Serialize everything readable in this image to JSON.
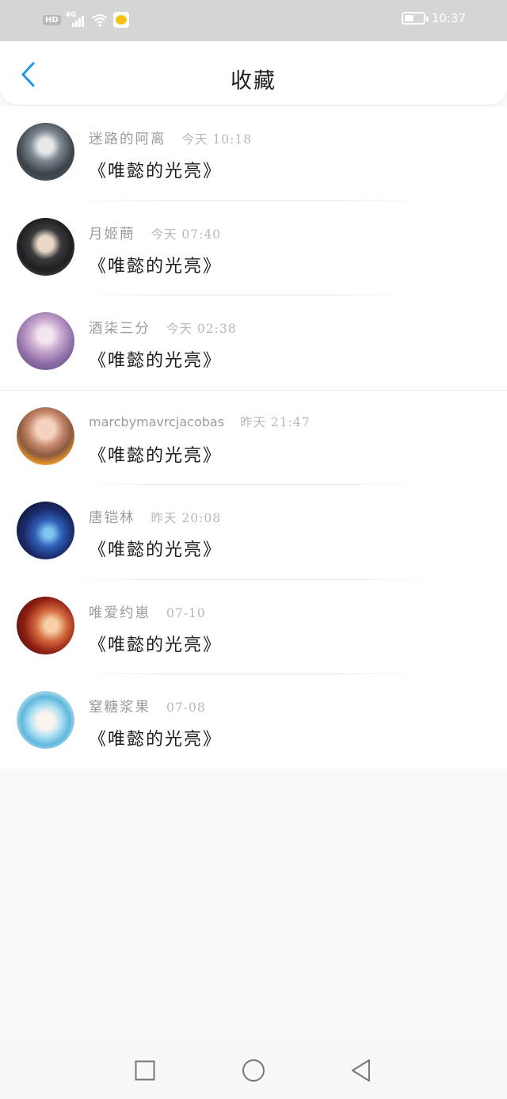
{
  "status_bar": {
    "network_badge": "HD",
    "network_type": "4G",
    "clock": "10:37"
  },
  "header": {
    "title": "收藏",
    "back_icon": "chevron-left-icon"
  },
  "favorites": [
    {
      "name": "迷路的阿离",
      "time": "今天  10:18",
      "title": "《唯懿的光亮》"
    },
    {
      "name": "月姬蔄",
      "time": "今天  07:40",
      "title": "《唯懿的光亮》"
    },
    {
      "name": "酒柒三分",
      "time": "今天  02:38",
      "title": "《唯懿的光亮》"
    },
    {
      "name": "marcbymavrcjacobas",
      "time": "昨天  21:47",
      "title": "《唯懿的光亮》"
    },
    {
      "name": "唐铠林",
      "time": "昨天  20:08",
      "title": "《唯懿的光亮》"
    },
    {
      "name": "唯爱约崽",
      "time": "07-10",
      "title": "《唯懿的光亮》"
    },
    {
      "name": "窒糖浆果",
      "time": "07-08",
      "title": "《唯懿的光亮》"
    }
  ],
  "system_nav": {
    "recent_icon": "square-icon",
    "home_icon": "circle-icon",
    "back_icon": "triangle-back-icon"
  },
  "colors": {
    "accent": "#2196e6",
    "status_bar": "#d5d5d5",
    "page_bg": "#faf8f9"
  }
}
